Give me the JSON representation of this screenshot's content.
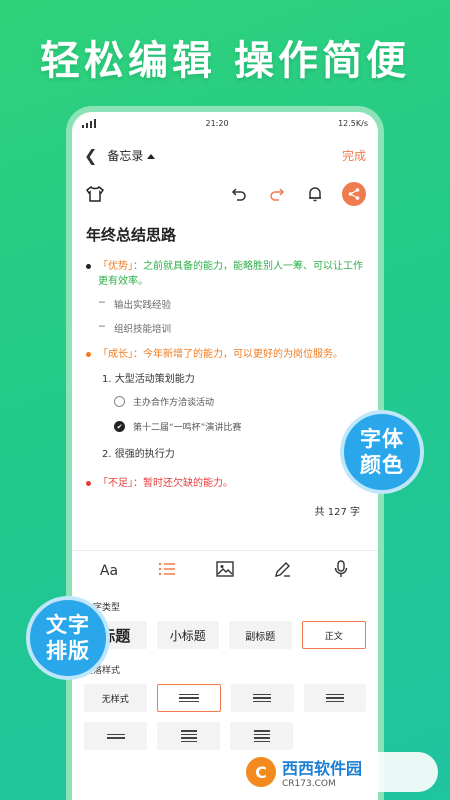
{
  "headline": "轻松编辑  操作简便",
  "status": {
    "time": "21:20",
    "speed": "12.5K/s"
  },
  "nav": {
    "title": "备忘录",
    "done": "完成"
  },
  "doc": {
    "title": "年终总结思路",
    "b1_label": "「优势」",
    "b1_text": "：之前就具备的能力，能略胜别人一筹、可以让工作更有效率。",
    "b1_sub1": "输出实践经验",
    "b1_sub2": "组织技能培训",
    "b2_label": "「成长」",
    "b2_text": "：今年新增了的能力，可以更好的为岗位服务。",
    "n1": "1. 大型活动策划能力",
    "task1": "主办合作方洽谈活动",
    "task2": "第十二届“一鸣杯”演讲比赛",
    "n2": "2. 很强的执行力",
    "b3_label": "「不足」",
    "b3_text": "：暂时还欠缺的能力。",
    "count": "共 127 字"
  },
  "tools": {
    "font": "Aa"
  },
  "panel": {
    "type_label": "文字类型",
    "types": [
      "标题",
      "小标题",
      "副标题",
      "正文"
    ],
    "para_label": "段落样式",
    "para_none": "无样式"
  },
  "badges": {
    "font_color": [
      "字体",
      "颜色"
    ],
    "layout": [
      "文字",
      "排版"
    ]
  },
  "watermark": {
    "name": "西西软件园",
    "domain": "CR173.COM"
  },
  "colors": {
    "accent": "#f07b4f",
    "green": "#2fae4b",
    "orange": "#f07b1f",
    "red": "#e73b3b",
    "badge": "#2aa7ea"
  }
}
